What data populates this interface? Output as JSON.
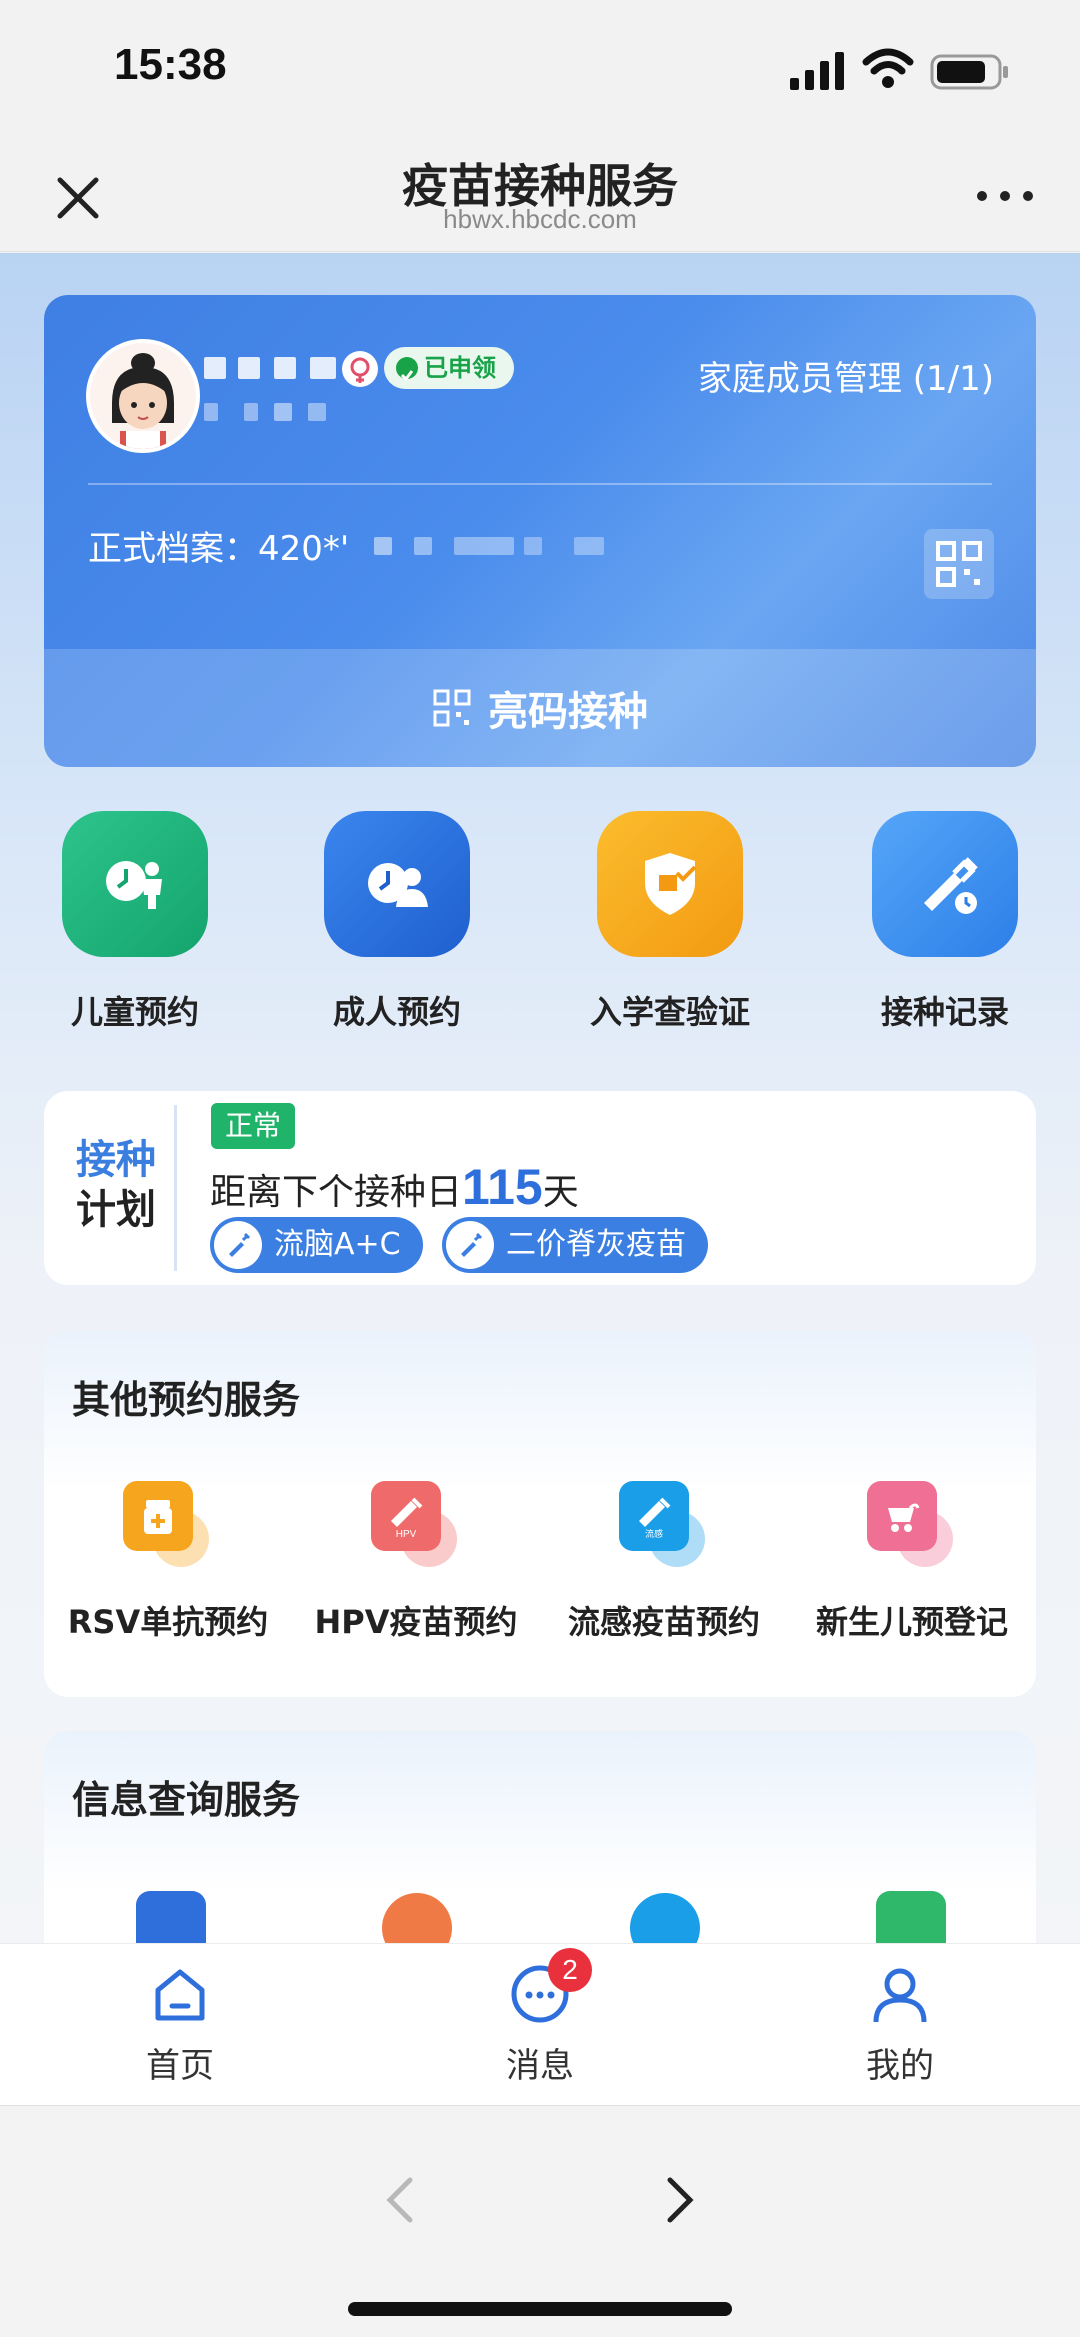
{
  "status_bar": {
    "time": "15:38"
  },
  "nav": {
    "title": "疫苗接种服务",
    "subtitle": "hbwx.hbcdc.com"
  },
  "profile": {
    "claimed_badge": "已申领",
    "family_link": "家庭成员管理 (1/1)",
    "record_label": "正式档案：420*'",
    "scan_label": "亮码接种"
  },
  "quick_actions": [
    {
      "label": "儿童预约",
      "icon": "child-appointment-icon",
      "color": "#1fb57f"
    },
    {
      "label": "成人预约",
      "icon": "adult-appointment-icon",
      "color": "#2f74e0"
    },
    {
      "label": "入学查验证",
      "icon": "school-verify-icon",
      "color": "#f8a51c"
    },
    {
      "label": "接种记录",
      "icon": "vaccination-record-icon",
      "color": "#3b8cf0"
    }
  ],
  "plan": {
    "title_line1": "接种",
    "title_line2": "计划",
    "status": "正常",
    "text_before": "距离下个接种日",
    "days": "115",
    "text_after": "天",
    "vaccines": [
      "流脑A+C",
      "二价脊灰疫苗"
    ]
  },
  "other_services": {
    "title": "其他预约服务",
    "items": [
      {
        "label": "RSV单抗预约",
        "icon": "rsv-icon",
        "color": "#f6a51f"
      },
      {
        "label": "HPV疫苗预约",
        "icon": "hpv-icon",
        "color": "#ef6b6b",
        "icon_text": "HPV"
      },
      {
        "label": "流感疫苗预约",
        "icon": "flu-icon",
        "color": "#1a9ee8",
        "icon_text": "流感"
      },
      {
        "label": "新生儿预登记",
        "icon": "newborn-icon",
        "color": "#f06f94"
      }
    ]
  },
  "info_services": {
    "title": "信息查询服务"
  },
  "tab_bar": {
    "home": "首页",
    "messages": "消息",
    "messages_badge": "2",
    "mine": "我的"
  },
  "colors": {
    "brand_blue": "#3f7fe4",
    "green": "#1fb57f",
    "badge_red": "#e8313c"
  }
}
